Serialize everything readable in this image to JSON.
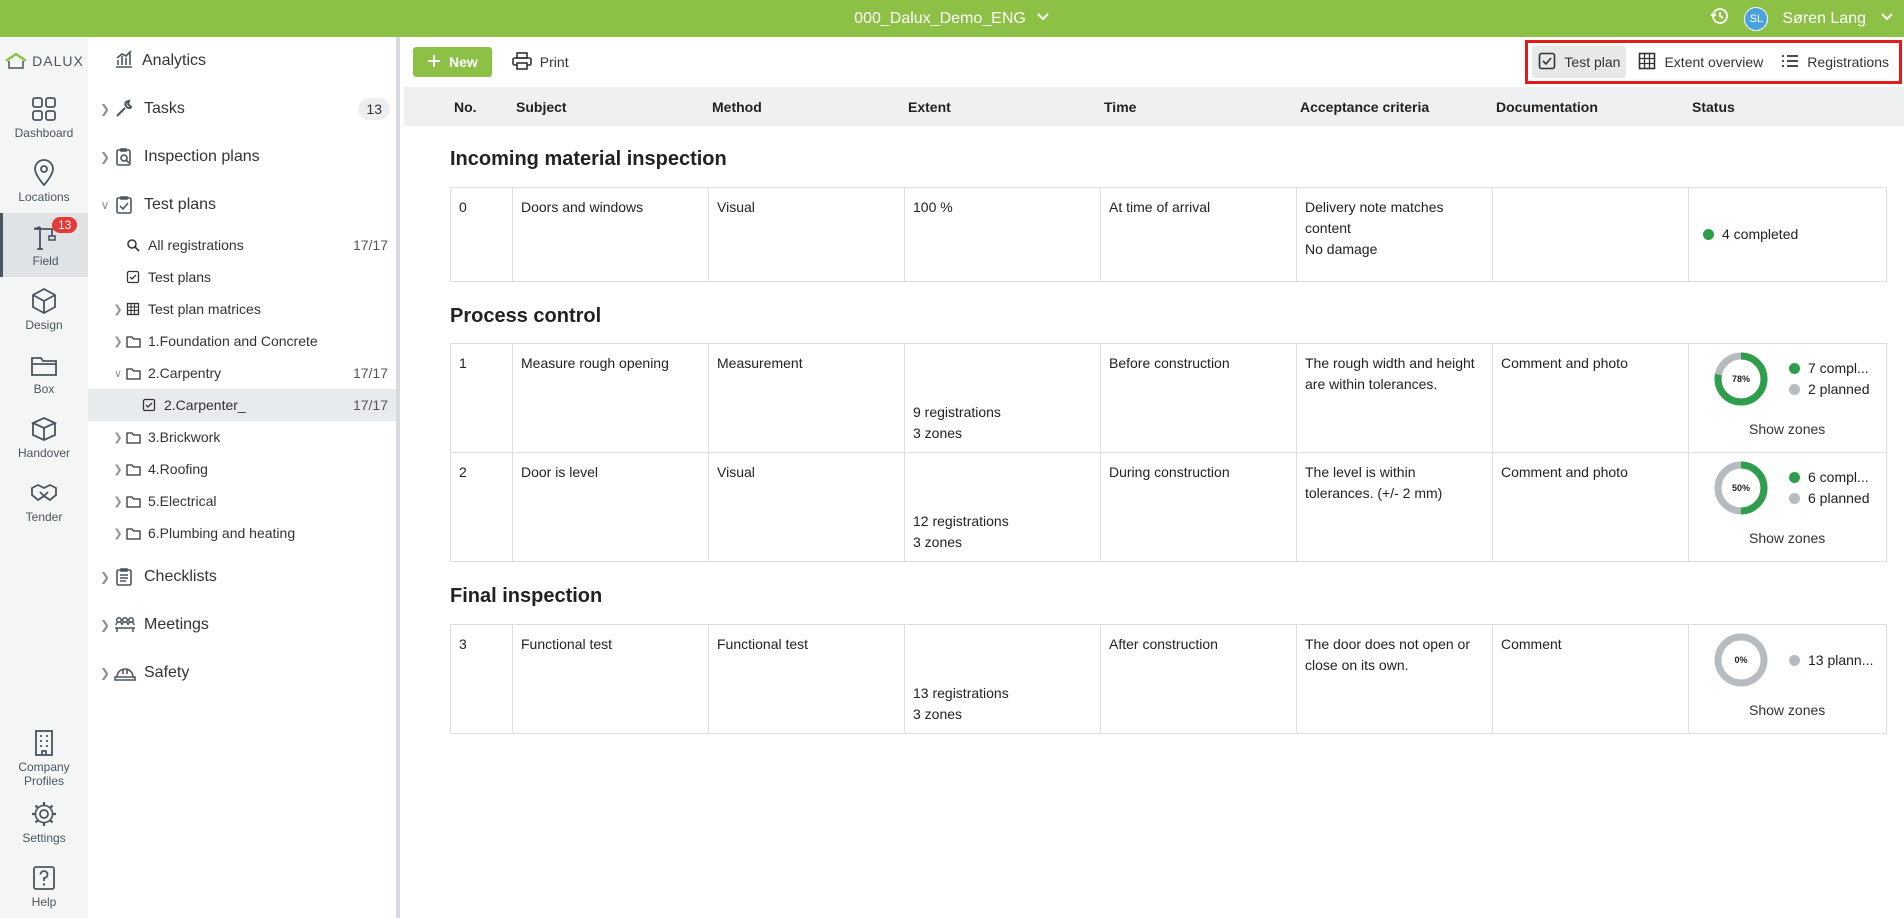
{
  "topbar": {
    "project": "000_Dalux_Demo_ENG",
    "user_initials": "SL",
    "user_name": "Søren Lang"
  },
  "rail": {
    "logo": "DALUX",
    "items": [
      {
        "label": "Dashboard",
        "icon": "grid-icon"
      },
      {
        "label": "Locations",
        "icon": "location-pin-icon"
      },
      {
        "label": "Field",
        "icon": "crane-icon",
        "badge": "13"
      },
      {
        "label": "Design",
        "icon": "cube-icon"
      },
      {
        "label": "Box",
        "icon": "folder-icon"
      },
      {
        "label": "Handover",
        "icon": "box-icon"
      },
      {
        "label": "Tender",
        "icon": "handshake-icon"
      }
    ],
    "bottom": [
      {
        "label": "Company Profiles",
        "icon": "building-icon"
      },
      {
        "label": "Settings",
        "icon": "gear-icon"
      },
      {
        "label": "Help",
        "icon": "help-icon"
      }
    ]
  },
  "sidebar": {
    "analytics": "Analytics",
    "tasks": "Tasks",
    "tasks_count": "13",
    "inspection_plans": "Inspection plans",
    "test_plans": "Test plans",
    "sub": {
      "all_registrations": "All registrations",
      "all_registrations_count": "17/17",
      "test_plans": "Test plans",
      "matrices": "Test plan matrices",
      "foundation": "1.Foundation and Concrete",
      "carpentry": "2.Carpentry",
      "carpentry_count": "17/17",
      "carpenter": "2.Carpenter_",
      "carpenter_count": "17/17",
      "brickwork": "3.Brickwork",
      "roofing": "4.Roofing",
      "electrical": "5.Electrical",
      "plumbing": "6.Plumbing and heating"
    },
    "checklists": "Checklists",
    "meetings": "Meetings",
    "safety": "Safety"
  },
  "toolbar": {
    "new_label": "New",
    "print_label": "Print",
    "views": {
      "test_plan": "Test plan",
      "extent_overview": "Extent overview",
      "registrations": "Registrations"
    }
  },
  "table": {
    "headers": {
      "no": "No.",
      "subject": "Subject",
      "method": "Method",
      "extent": "Extent",
      "time": "Time",
      "acceptance": "Acceptance criteria",
      "documentation": "Documentation",
      "status": "Status"
    },
    "sections": {
      "incoming": "Incoming material inspection",
      "process": "Process control",
      "final": "Final inspection"
    },
    "rows": {
      "r0": {
        "no": "0",
        "subject": "Doors and windows",
        "method": "Visual",
        "extent": "100 %",
        "time": "At time of arrival",
        "acceptance_1": "Delivery note matches",
        "acceptance_2": "content",
        "acceptance_3": "No damage",
        "documentation": "",
        "status_completed": "4 completed"
      },
      "r1": {
        "no": "1",
        "subject": "Measure rough opening",
        "method": "Measurement",
        "extent_regs": "9 registrations",
        "extent_zones": "3 zones",
        "time": "Before construction",
        "acceptance_1": "The rough width and height",
        "acceptance_2": "are within tolerances.",
        "documentation": "Comment and photo",
        "donut_pct": "78%",
        "progress": 0.78,
        "legend_completed": "7 compl...",
        "legend_planned": "2 planned",
        "show_zones": "Show zones"
      },
      "r2": {
        "no": "2",
        "subject": "Door is level",
        "method": "Visual",
        "extent_regs": "12 registrations",
        "extent_zones": "3 zones",
        "time": "During construction",
        "acceptance_1": "The level is within",
        "acceptance_2": "tolerances. (+/- 2 mm)",
        "documentation": "Comment and photo",
        "donut_pct": "50%",
        "progress": 0.5,
        "legend_completed": "6 compl...",
        "legend_planned": "6 planned",
        "show_zones": "Show zones"
      },
      "r3": {
        "no": "3",
        "subject": "Functional test",
        "method": "Functional test",
        "extent_regs": "13 registrations",
        "extent_zones": "3 zones",
        "time": "After construction",
        "acceptance_1": "The door does not open or",
        "acceptance_2": "close on its own.",
        "documentation": "Comment",
        "donut_pct": "0%",
        "progress": 0,
        "legend_planned": "13 plann...",
        "show_zones": "Show zones"
      }
    }
  },
  "colors": {
    "brand": "#8dc146",
    "completed": "#2e9d4c",
    "planned": "#b6bbbf",
    "highlight": "#e21b1b"
  }
}
